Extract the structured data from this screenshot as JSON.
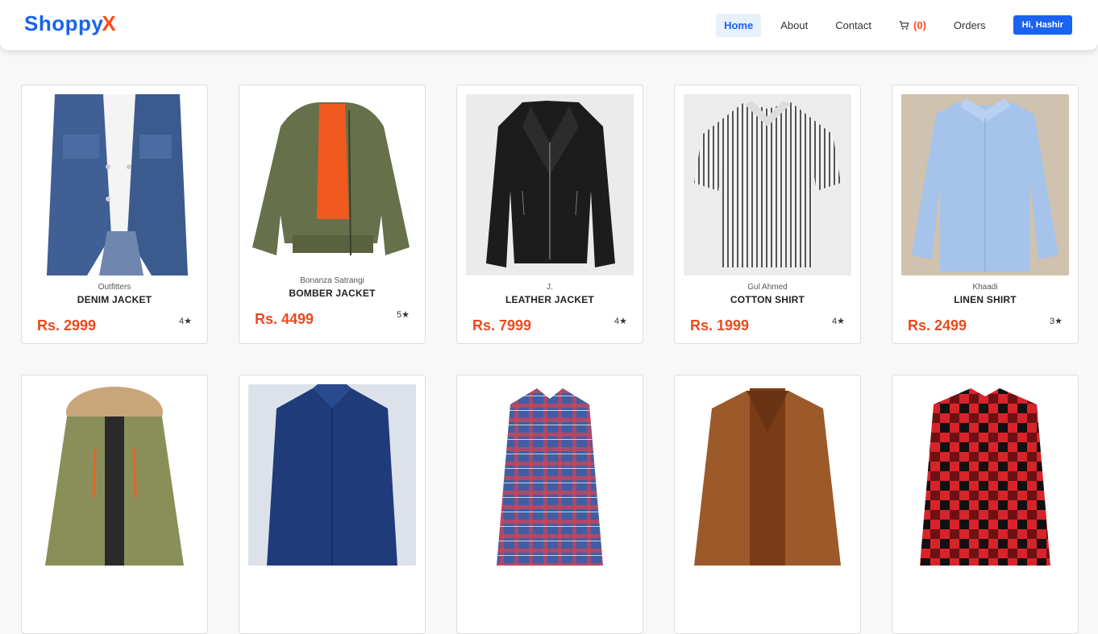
{
  "brand": {
    "main": "Shoppy",
    "accent": "X"
  },
  "nav": {
    "items": [
      "Home",
      "About",
      "Contact"
    ],
    "cart_count": "(0)",
    "orders": "Orders",
    "user": "Hi, Hashir"
  },
  "colors": {
    "primary": "#1a62f0",
    "accent": "#ff4a1c",
    "price": "#ea4a1f"
  },
  "products": [
    {
      "brand": "Outfitters",
      "name": "DENIM JACKET",
      "price": "Rs. 2999",
      "rating": "4★"
    },
    {
      "brand": "Bonanza Satrangi",
      "name": "BOMBER JACKET",
      "price": "Rs. 4499",
      "rating": "5★"
    },
    {
      "brand": "J.",
      "name": "LEATHER JACKET",
      "price": "Rs. 7999",
      "rating": "4★"
    },
    {
      "brand": "Gul Ahmed",
      "name": "COTTON SHIRT",
      "price": "Rs. 1999",
      "rating": "4★"
    },
    {
      "brand": "Khaadi",
      "name": "LINEN SHIRT",
      "price": "Rs. 2499",
      "rating": "3★"
    },
    {
      "brand": "",
      "name": "",
      "price": "",
      "rating": ""
    },
    {
      "brand": "",
      "name": "",
      "price": "",
      "rating": ""
    },
    {
      "brand": "",
      "name": "",
      "price": "",
      "rating": ""
    },
    {
      "brand": "",
      "name": "",
      "price": "",
      "rating": ""
    },
    {
      "brand": "",
      "name": "",
      "price": "",
      "rating": ""
    }
  ]
}
